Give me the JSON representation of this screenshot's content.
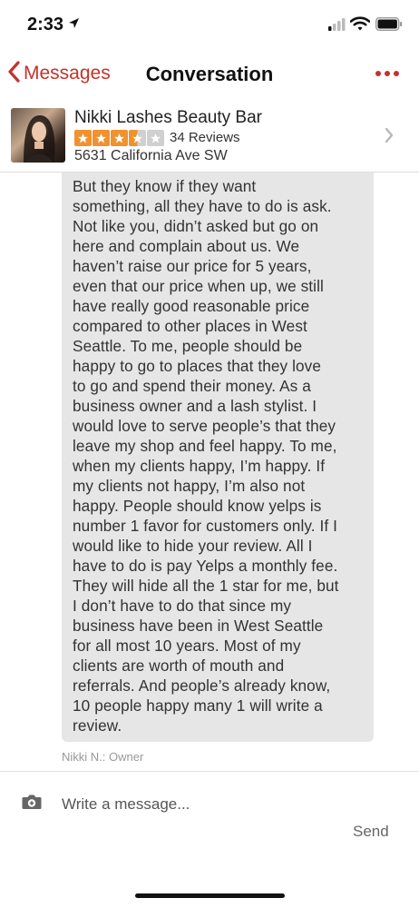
{
  "status_bar": {
    "time": "2:33"
  },
  "nav": {
    "back_label": "Messages",
    "title": "Conversation"
  },
  "business": {
    "name": "Nikki Lashes Beauty Bar",
    "rating": 3.5,
    "review_count": "34 Reviews",
    "address": "5631 California Ave SW"
  },
  "message": {
    "text": "But they know if they want\nsomething, all they have to do is ask.\nNot like you, didn’t asked but go on\nhere and complain about us. We\nhaven’t raise our price for 5 years,\neven that our price when up, we still\nhave really good reasonable price\ncompared to other places in West\nSeattle. To me, people should be\nhappy to go to places that they love\nto go and spend their money. As a\nbusiness owner and a lash stylist. I\nwould love to serve people’s that they\nleave my shop and feel happy. To me,\nwhen my clients happy, I’m happy. If\nmy clients not happy, I’m also not\nhappy. People should know yelps is\nnumber 1 favor for customers only. If I\nwould like to hide your review. All I\nhave to do is pay Yelps a monthly fee.\nThey will hide all the 1 star for me, but\nI don’t have to do that since my\nbusiness have been in West Seattle\nfor all most  10 years. Most of my\nclients are worth of mouth and\nreferrals. And people’s already know,\n10 people happy many 1 will write a\nreview.",
    "sender": "Nikki N.: Owner"
  },
  "composer": {
    "placeholder": "Write a message...",
    "send_label": "Send"
  },
  "colors": {
    "accent": "#c5322b",
    "star_filled": "#f0922f",
    "star_empty": "#d0d0d0",
    "bubble": "#e6e6e6"
  },
  "icons": {
    "back": "chevron-left-icon",
    "more": "more-dots-icon",
    "camera": "camera-icon",
    "chevron": "chevron-right-icon"
  }
}
